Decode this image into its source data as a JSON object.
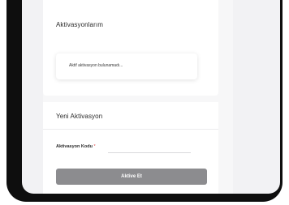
{
  "activations_card": {
    "title": "Aktivasyonlarım",
    "empty_message": "Aktif aktivasyon bulunamadı..."
  },
  "new_activation_card": {
    "title": "Yeni Aktivasyon",
    "code_label": "Aktivasyon Kodu",
    "required_marker": "*",
    "code_value": "",
    "submit_label": "Aktive Et"
  },
  "colors": {
    "button_bg": "#8c8c8f",
    "required": "#e04646",
    "device_frame": "#0e0e0e"
  }
}
